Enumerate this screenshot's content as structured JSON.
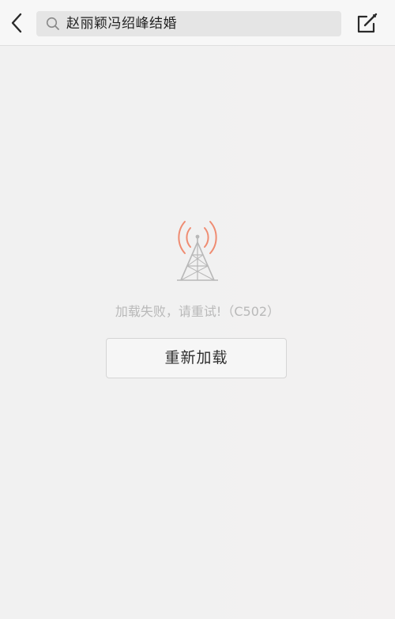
{
  "header": {
    "search_query": "赵丽颖冯绍峰结婚"
  },
  "error": {
    "message": "加载失败，请重试!（C502）",
    "reload_label": "重新加载"
  },
  "icons": {
    "back": "chevron-left-icon",
    "search": "search-icon",
    "compose": "compose-icon",
    "signal": "signal-tower-icon"
  },
  "colors": {
    "signal_waves": "#ef8c72",
    "tower": "#b8b8b8",
    "background": "#f1f0f0"
  }
}
